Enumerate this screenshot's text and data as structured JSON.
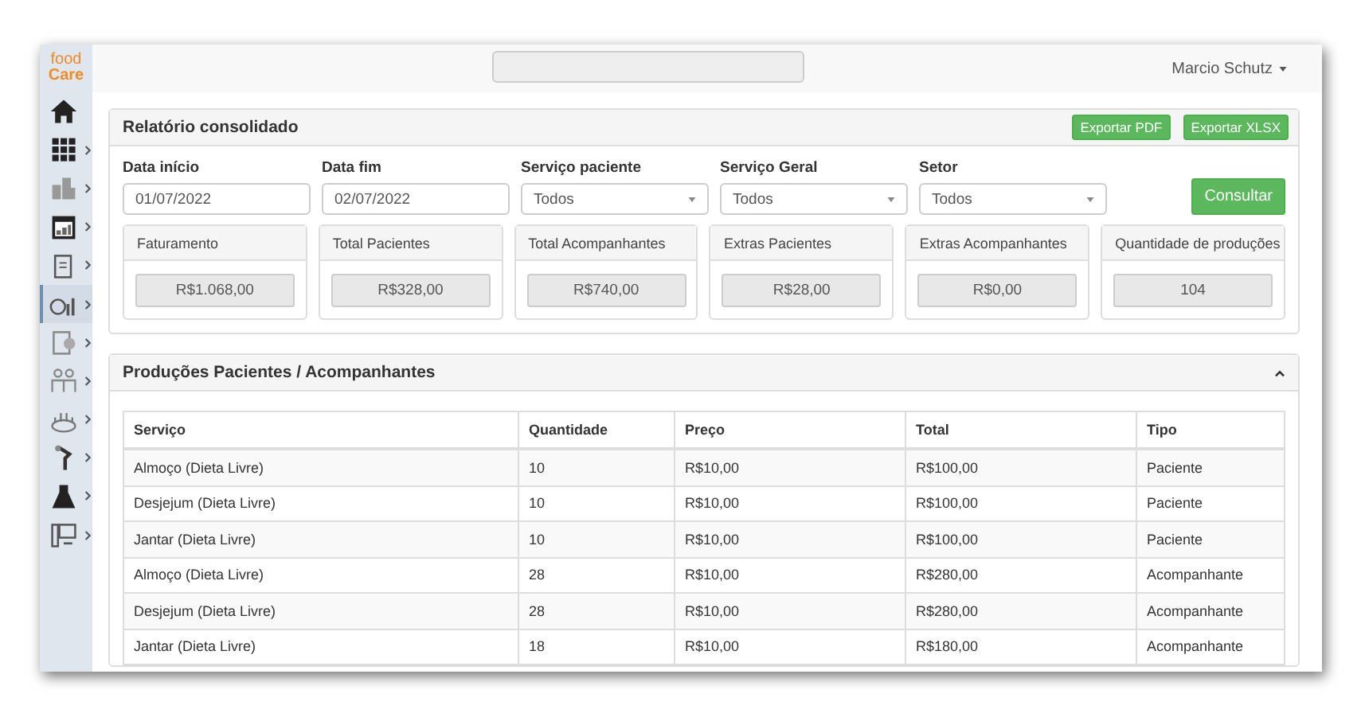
{
  "logo": {
    "line_1": "food",
    "line_2": "Care"
  },
  "sidebar": {
    "items": [
      {
        "submenu": false,
        "selected": false
      },
      {
        "submenu": true,
        "selected": false
      },
      {
        "submenu": true,
        "selected": false
      },
      {
        "submenu": true,
        "selected": false
      },
      {
        "submenu": true,
        "selected": false
      },
      {
        "submenu": true,
        "selected": true
      },
      {
        "submenu": true,
        "selected": false
      },
      {
        "submenu": true,
        "selected": false
      },
      {
        "submenu": true,
        "selected": false
      },
      {
        "submenu": true,
        "selected": false
      },
      {
        "submenu": true,
        "selected": false
      },
      {
        "submenu": true,
        "selected": false
      }
    ]
  },
  "topbar": {
    "user": "Marcio Schutz"
  },
  "report": {
    "title": "Relatório consolidado",
    "buttons": [
      "Exportar PDF",
      "Exportar XLSX"
    ],
    "filters": [
      {
        "label": "Data início",
        "kind": "date",
        "value": "01/07/2022"
      },
      {
        "label": "Data fim",
        "kind": "date",
        "value": "02/07/2022"
      },
      {
        "label": "Serviço paciente",
        "kind": "select",
        "value": "Todos"
      },
      {
        "label": "Serviço Geral",
        "kind": "select",
        "value": "Todos"
      },
      {
        "label": "Setor",
        "kind": "select",
        "value": "Todos"
      }
    ],
    "submit": "Consultar",
    "summary": [
      {
        "label": "Faturamento",
        "value": "R$1.068,00"
      },
      {
        "label": "Total Pacientes",
        "value": "R$328,00"
      },
      {
        "label": "Total Acompanhantes",
        "value": "R$740,00"
      },
      {
        "label": "Extras Pacientes",
        "value": "R$28,00"
      },
      {
        "label": "Extras Acompanhantes",
        "value": "R$0,00"
      },
      {
        "label": "Quantidade de produções",
        "value": "104"
      }
    ]
  },
  "productions": {
    "title": "Produções Pacientes / Acompanhantes",
    "expanded": true,
    "table": {
      "columns": [
        "Serviço",
        "Quantidade",
        "Preço",
        "Total",
        "Tipo"
      ],
      "rows": [
        [
          "Almoço (Dieta Livre)",
          "10",
          "R$10,00",
          "R$100,00",
          "Paciente"
        ],
        [
          "Desjejum (Dieta Livre)",
          "10",
          "R$10,00",
          "R$100,00",
          "Paciente"
        ],
        [
          "Jantar (Dieta Livre)",
          "10",
          "R$10,00",
          "R$100,00",
          "Paciente"
        ],
        [
          "Almoço (Dieta Livre)",
          "28",
          "R$10,00",
          "R$280,00",
          "Acompanhante"
        ],
        [
          "Desjejum (Dieta Livre)",
          "28",
          "R$10,00",
          "R$280,00",
          "Acompanhante"
        ],
        [
          "Jantar (Dieta Livre)",
          "18",
          "R$10,00",
          "R$180,00",
          "Acompanhante"
        ]
      ]
    }
  }
}
